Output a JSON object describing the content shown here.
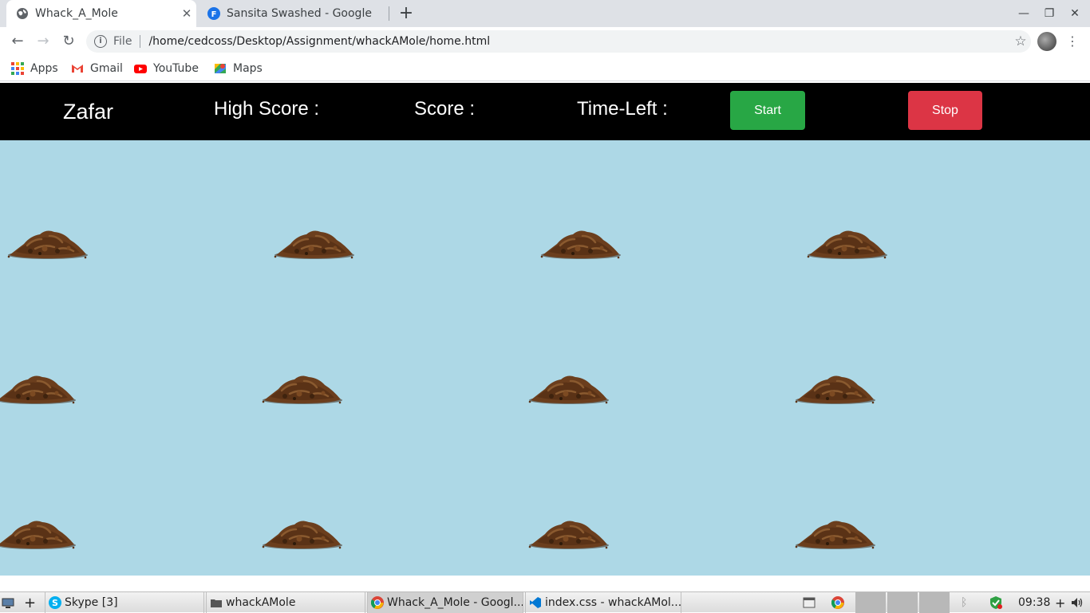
{
  "browser": {
    "tabs": [
      {
        "title": "Whack_A_Mole",
        "active": true,
        "icon": "globe-icon"
      },
      {
        "title": "Sansita Swashed - Google",
        "active": false,
        "icon": "google-fonts-icon"
      }
    ],
    "address": {
      "scheme_label": "File",
      "url": "/home/cedcoss/Desktop/Assignment/whackAMole/home.html"
    },
    "bookmarks": [
      {
        "label": "Apps",
        "icon": "apps-grid-icon"
      },
      {
        "label": "Gmail",
        "icon": "gmail-icon"
      },
      {
        "label": "YouTube",
        "icon": "youtube-icon"
      },
      {
        "label": "Maps",
        "icon": "maps-icon"
      }
    ]
  },
  "game": {
    "player_name": "Zafar",
    "high_score_label": "High Score :",
    "score_label": "Score :",
    "time_left_label": "Time-Left :",
    "start_label": "Start",
    "stop_label": "Stop",
    "colors": {
      "header_bg": "#000000",
      "field_bg": "#add8e6",
      "start": "#28a745",
      "stop": "#dc3545"
    },
    "holes": [
      {
        "row": 1,
        "col": 1
      },
      {
        "row": 1,
        "col": 2
      },
      {
        "row": 1,
        "col": 3
      },
      {
        "row": 1,
        "col": 4
      },
      {
        "row": 2,
        "col": 1
      },
      {
        "row": 2,
        "col": 2
      },
      {
        "row": 2,
        "col": 3
      },
      {
        "row": 2,
        "col": 4
      },
      {
        "row": 3,
        "col": 1
      },
      {
        "row": 3,
        "col": 2
      },
      {
        "row": 3,
        "col": 3
      },
      {
        "row": 3,
        "col": 4
      }
    ]
  },
  "taskbar": {
    "windows": [
      {
        "label": "Skype [3]",
        "icon": "skype-icon"
      },
      {
        "label": "whackAMole",
        "icon": "folder-icon"
      },
      {
        "label": "Whack_A_Mole - Googl...",
        "icon": "chrome-icon",
        "active": true
      },
      {
        "label": "index.css - whackAMol...",
        "icon": "vscode-icon"
      }
    ],
    "clock": "09:38"
  }
}
